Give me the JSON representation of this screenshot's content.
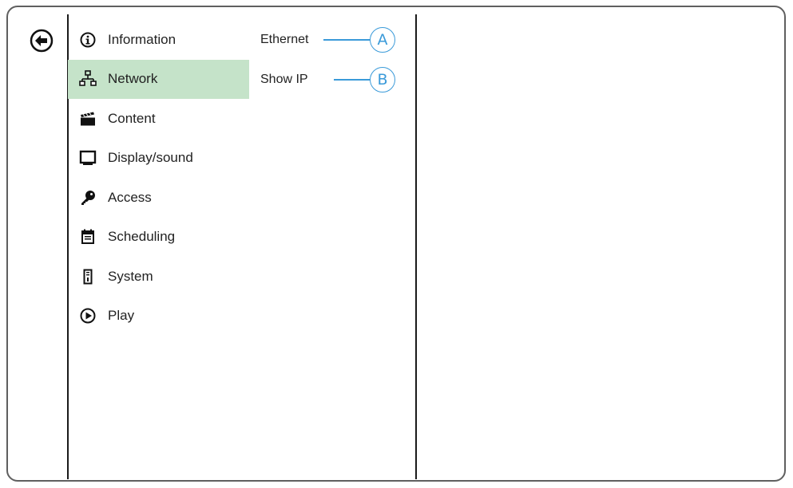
{
  "menu": {
    "items": [
      {
        "label": "Information",
        "icon": "info-icon"
      },
      {
        "label": "Network",
        "icon": "network-icon",
        "selected": true
      },
      {
        "label": "Content",
        "icon": "clapperboard-icon"
      },
      {
        "label": "Display/sound",
        "icon": "monitor-icon"
      },
      {
        "label": "Access",
        "icon": "key-icon"
      },
      {
        "label": "Scheduling",
        "icon": "calendar-icon"
      },
      {
        "label": "System",
        "icon": "tower-icon"
      },
      {
        "label": "Play",
        "icon": "play-icon"
      }
    ]
  },
  "submenu": {
    "items": [
      {
        "label": "Ethernet"
      },
      {
        "label": "Show IP"
      }
    ]
  },
  "callouts": [
    "A",
    "B"
  ],
  "colors": {
    "selected_bg": "#c5e3c9",
    "callout": "#3a9ad9",
    "frame": "#5f5f5f"
  }
}
